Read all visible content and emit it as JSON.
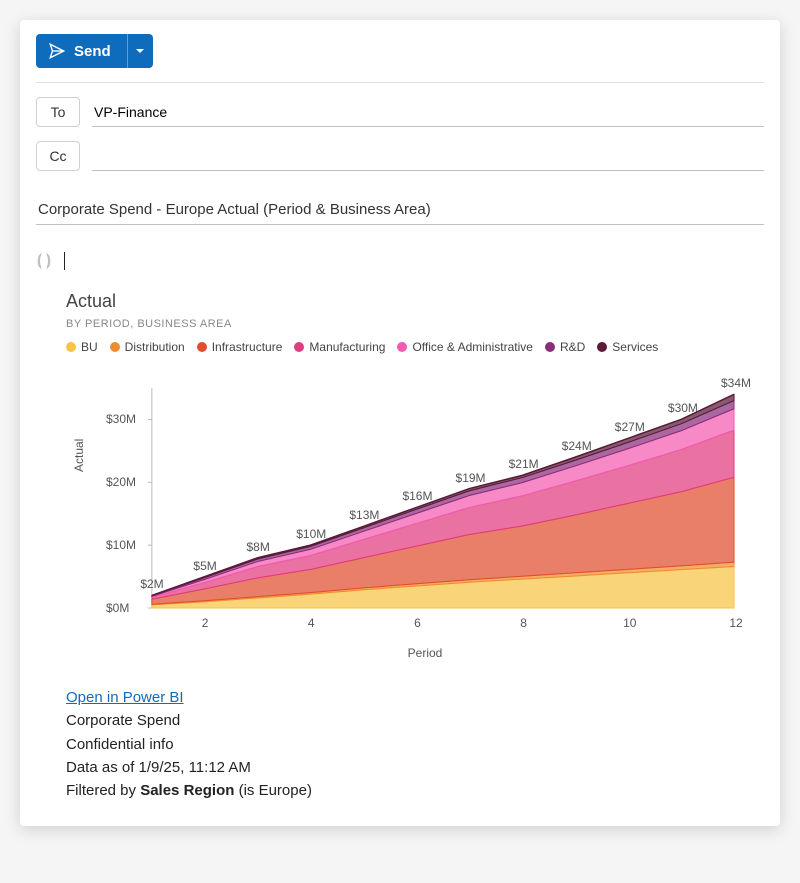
{
  "compose": {
    "send_label": "Send",
    "to_label": "To",
    "cc_label": "Cc",
    "to_value": "VP-Finance",
    "cc_value": "",
    "subject": "Corporate Spend - Europe Actual (Period & Business Area)"
  },
  "chart_data": {
    "type": "area",
    "title": "Actual",
    "subtitle": "BY PERIOD, BUSINESS AREA",
    "xlabel": "Period",
    "ylabel": "Actual",
    "x": [
      1,
      2,
      3,
      4,
      5,
      6,
      7,
      8,
      9,
      10,
      11,
      12
    ],
    "x_ticks": [
      2,
      4,
      6,
      8,
      10,
      12
    ],
    "y_ticks_M": [
      0,
      10,
      20,
      30
    ],
    "ylim": [
      0,
      35
    ],
    "totals_M": [
      2,
      5,
      8,
      10,
      13,
      16,
      19,
      21,
      24,
      27,
      30,
      34
    ],
    "total_label_prefix": "$",
    "total_label_suffix": "M",
    "series": [
      {
        "name": "BU",
        "color": "#f7c445",
        "values_M": [
          0.5,
          1.0,
          1.6,
          2.2,
          2.9,
          3.5,
          4.1,
          4.6,
          5.1,
          5.6,
          6.1,
          6.6
        ]
      },
      {
        "name": "Distribution",
        "color": "#f08c2e",
        "values_M": [
          0.1,
          0.15,
          0.2,
          0.25,
          0.3,
          0.35,
          0.4,
          0.45,
          0.5,
          0.55,
          0.6,
          0.7
        ]
      },
      {
        "name": "Infrastructure",
        "color": "#e04e2e",
        "values_M": [
          0.8,
          1.9,
          3.0,
          3.7,
          4.8,
          6.0,
          7.2,
          8.0,
          9.2,
          10.5,
          11.8,
          13.5
        ]
      },
      {
        "name": "Manufacturing",
        "color": "#e23b80",
        "values_M": [
          0.3,
          1.0,
          1.8,
          2.2,
          2.9,
          3.6,
          4.3,
          4.8,
          5.4,
          6.0,
          6.7,
          7.5
        ]
      },
      {
        "name": "Office & Administrative",
        "color": "#f35bb0",
        "values_M": [
          0.15,
          0.5,
          0.8,
          1.0,
          1.3,
          1.6,
          1.9,
          2.1,
          2.4,
          2.7,
          3.0,
          3.4
        ]
      },
      {
        "name": "R&D",
        "color": "#8a2d7a",
        "values_M": [
          0.1,
          0.3,
          0.4,
          0.45,
          0.55,
          0.65,
          0.75,
          0.8,
          0.9,
          1.0,
          1.1,
          1.3
        ]
      },
      {
        "name": "Services",
        "color": "#5a1a38",
        "values_M": [
          0.05,
          0.15,
          0.2,
          0.2,
          0.25,
          0.3,
          0.35,
          0.35,
          0.5,
          0.65,
          0.7,
          1.0
        ]
      }
    ]
  },
  "footer": {
    "link_label": "Open in Power BI",
    "line1": "Corporate Spend",
    "line2": "Confidential info",
    "line3": "Data as of 1/9/25, 11:12 AM",
    "filter_prefix": "Filtered by ",
    "filter_bold": "Sales Region",
    "filter_suffix": " (is Europe)"
  }
}
